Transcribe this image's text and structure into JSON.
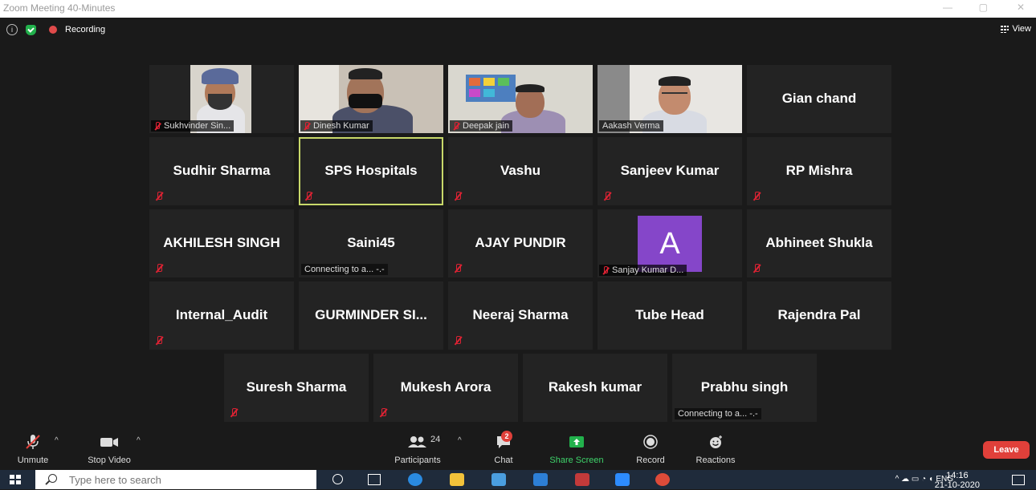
{
  "window": {
    "title": "Zoom Meeting 40-Minutes"
  },
  "topbar": {
    "recording_label": "Recording",
    "view_label": "View"
  },
  "tiles": [
    {
      "name": "Sukhvinder Sin...",
      "type": "video",
      "muted": true
    },
    {
      "name": "Dinesh Kumar",
      "type": "video",
      "muted": true
    },
    {
      "name": "Deepak jain",
      "type": "video",
      "muted": true
    },
    {
      "name": "Aakash Verma",
      "type": "video",
      "muted": false
    },
    {
      "name": "Gian chand",
      "type": "name",
      "muted": false
    },
    {
      "name": "Sudhir Sharma",
      "type": "name",
      "muted": true
    },
    {
      "name": "SPS Hospitals",
      "type": "name",
      "muted": true,
      "active": true
    },
    {
      "name": "Vashu",
      "type": "name",
      "muted": true
    },
    {
      "name": "Sanjeev Kumar",
      "type": "name",
      "muted": true
    },
    {
      "name": "RP Mishra",
      "type": "name",
      "muted": true
    },
    {
      "name": "AKHILESH SINGH",
      "type": "name",
      "muted": true
    },
    {
      "name": "Saini45",
      "type": "name",
      "muted": false,
      "status": "Connecting to a... -.-"
    },
    {
      "name": "AJAY PUNDIR",
      "type": "name",
      "muted": true
    },
    {
      "name": "Sanjay Kumar D...",
      "type": "avatar",
      "muted": true,
      "avatar_letter": "A"
    },
    {
      "name": "Abhineet Shukla",
      "type": "name",
      "muted": true
    },
    {
      "name": "Internal_Audit",
      "type": "name",
      "muted": true
    },
    {
      "name": "GURMINDER SI...",
      "type": "name",
      "muted": false
    },
    {
      "name": "Neeraj Sharma",
      "type": "name",
      "muted": true
    },
    {
      "name": "Tube Head",
      "type": "name",
      "muted": false
    },
    {
      "name": "Rajendra Pal",
      "type": "name",
      "muted": false
    },
    {
      "name": "Suresh Sharma",
      "type": "name",
      "muted": true
    },
    {
      "name": "Mukesh Arora",
      "type": "name",
      "muted": true
    },
    {
      "name": "Rakesh kumar",
      "type": "name",
      "muted": false
    },
    {
      "name": "Prabhu singh",
      "type": "name",
      "muted": false,
      "status": "Connecting to a... -.-"
    }
  ],
  "toolbar": {
    "unmute": "Unmute",
    "stop_video": "Stop Video",
    "participants": "Participants",
    "participant_count": "24",
    "chat": "Chat",
    "chat_badge": "2",
    "share_screen": "Share Screen",
    "record": "Record",
    "reactions": "Reactions",
    "leave": "Leave"
  },
  "taskbar": {
    "search_placeholder": "Type here to search",
    "language": "ENG",
    "time": "14:16",
    "date": "21-10-2020"
  },
  "colors": {
    "accent_green": "#22b14c",
    "leave_red": "#e0403a",
    "active_border": "#c8d96a",
    "avatar_purple": "#8546c9"
  }
}
